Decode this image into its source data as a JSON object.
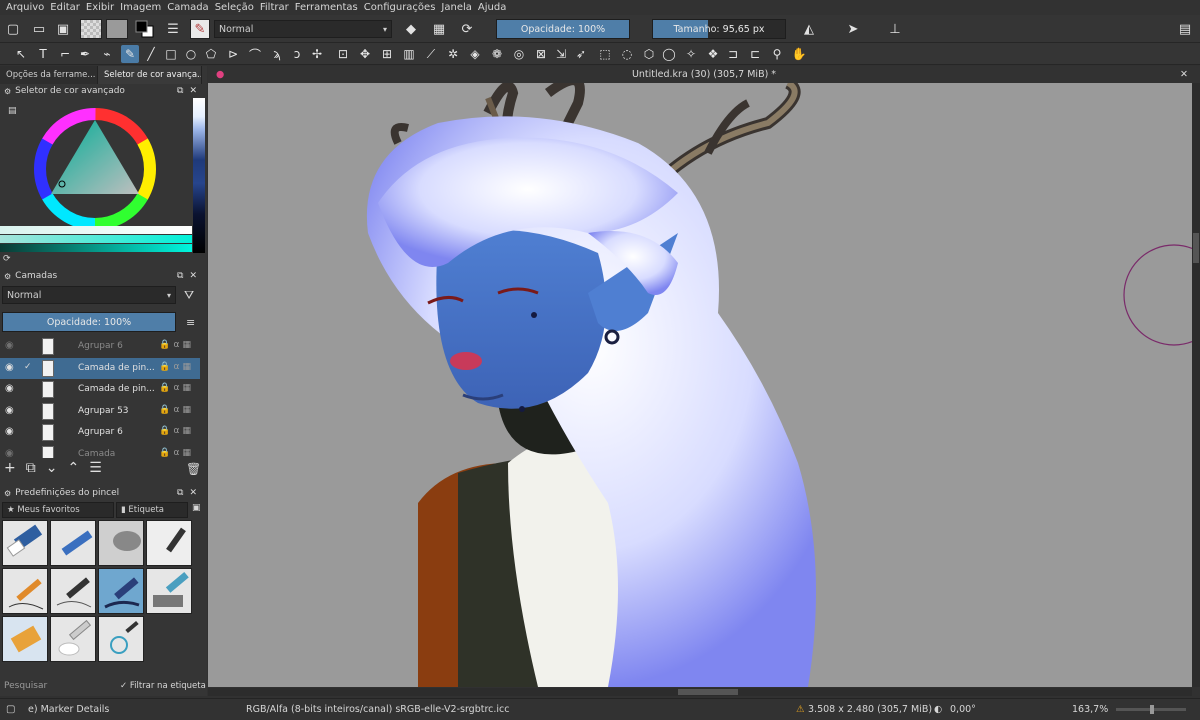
{
  "menu": [
    "Arquivo",
    "Editar",
    "Exibir",
    "Imagem",
    "Camada",
    "Seleção",
    "Filtrar",
    "Ferramentas",
    "Configurações",
    "Janela",
    "Ajuda"
  ],
  "toolbar": {
    "blend_mode": "Normal",
    "opacity_label": "Opacidade: 100%",
    "opacity_value": 1.0,
    "size_label": "Tamanho: 95,65 px",
    "size_fill": 0.42
  },
  "left_dock": {
    "tabs": [
      "Opções da ferrame...",
      "Seletor de cor avança..."
    ],
    "color_selector_title": "Seletor de cor avançado",
    "layers_title": "Camadas",
    "layers_blend": "Normal",
    "layers_opacity": "Opacidade: 100%",
    "layers": [
      {
        "name": "Agrupar 6",
        "visible": false,
        "selected": false,
        "dim": true
      },
      {
        "name": "Camada de pin...",
        "visible": true,
        "selected": true,
        "dim": false
      },
      {
        "name": "Camada de pin...",
        "visible": true,
        "selected": false,
        "dim": false
      },
      {
        "name": "Agrupar 53",
        "visible": true,
        "selected": false,
        "dim": false
      },
      {
        "name": "Agrupar 6",
        "visible": true,
        "selected": false,
        "dim": false
      },
      {
        "name": "Camada",
        "visible": false,
        "selected": false,
        "dim": true
      }
    ],
    "brush_presets_title": "Predefinições do pincel",
    "presets_tag": "Meus favoritos",
    "presets_tag_button": "Etiqueta",
    "search_placeholder": "Pesquisar",
    "filter_label": "Filtrar na etiqueta"
  },
  "document": {
    "title": "Untitled.kra (30) (305,7 MiB) *"
  },
  "status": {
    "brush_name": "e) Marker Details",
    "color_space": "RGB/Alfa (8-bits inteiros/canal)  sRGB-elle-V2-srgbtrc.icc",
    "image_size": "3.508 x 2.480 (305,7 MiB)",
    "rotation": "0,00°",
    "zoom": "163,7%"
  },
  "colors": {
    "accent": "#4f7ea8",
    "canvas_bg": "#9a9a9a",
    "panel_bg": "#353535"
  }
}
